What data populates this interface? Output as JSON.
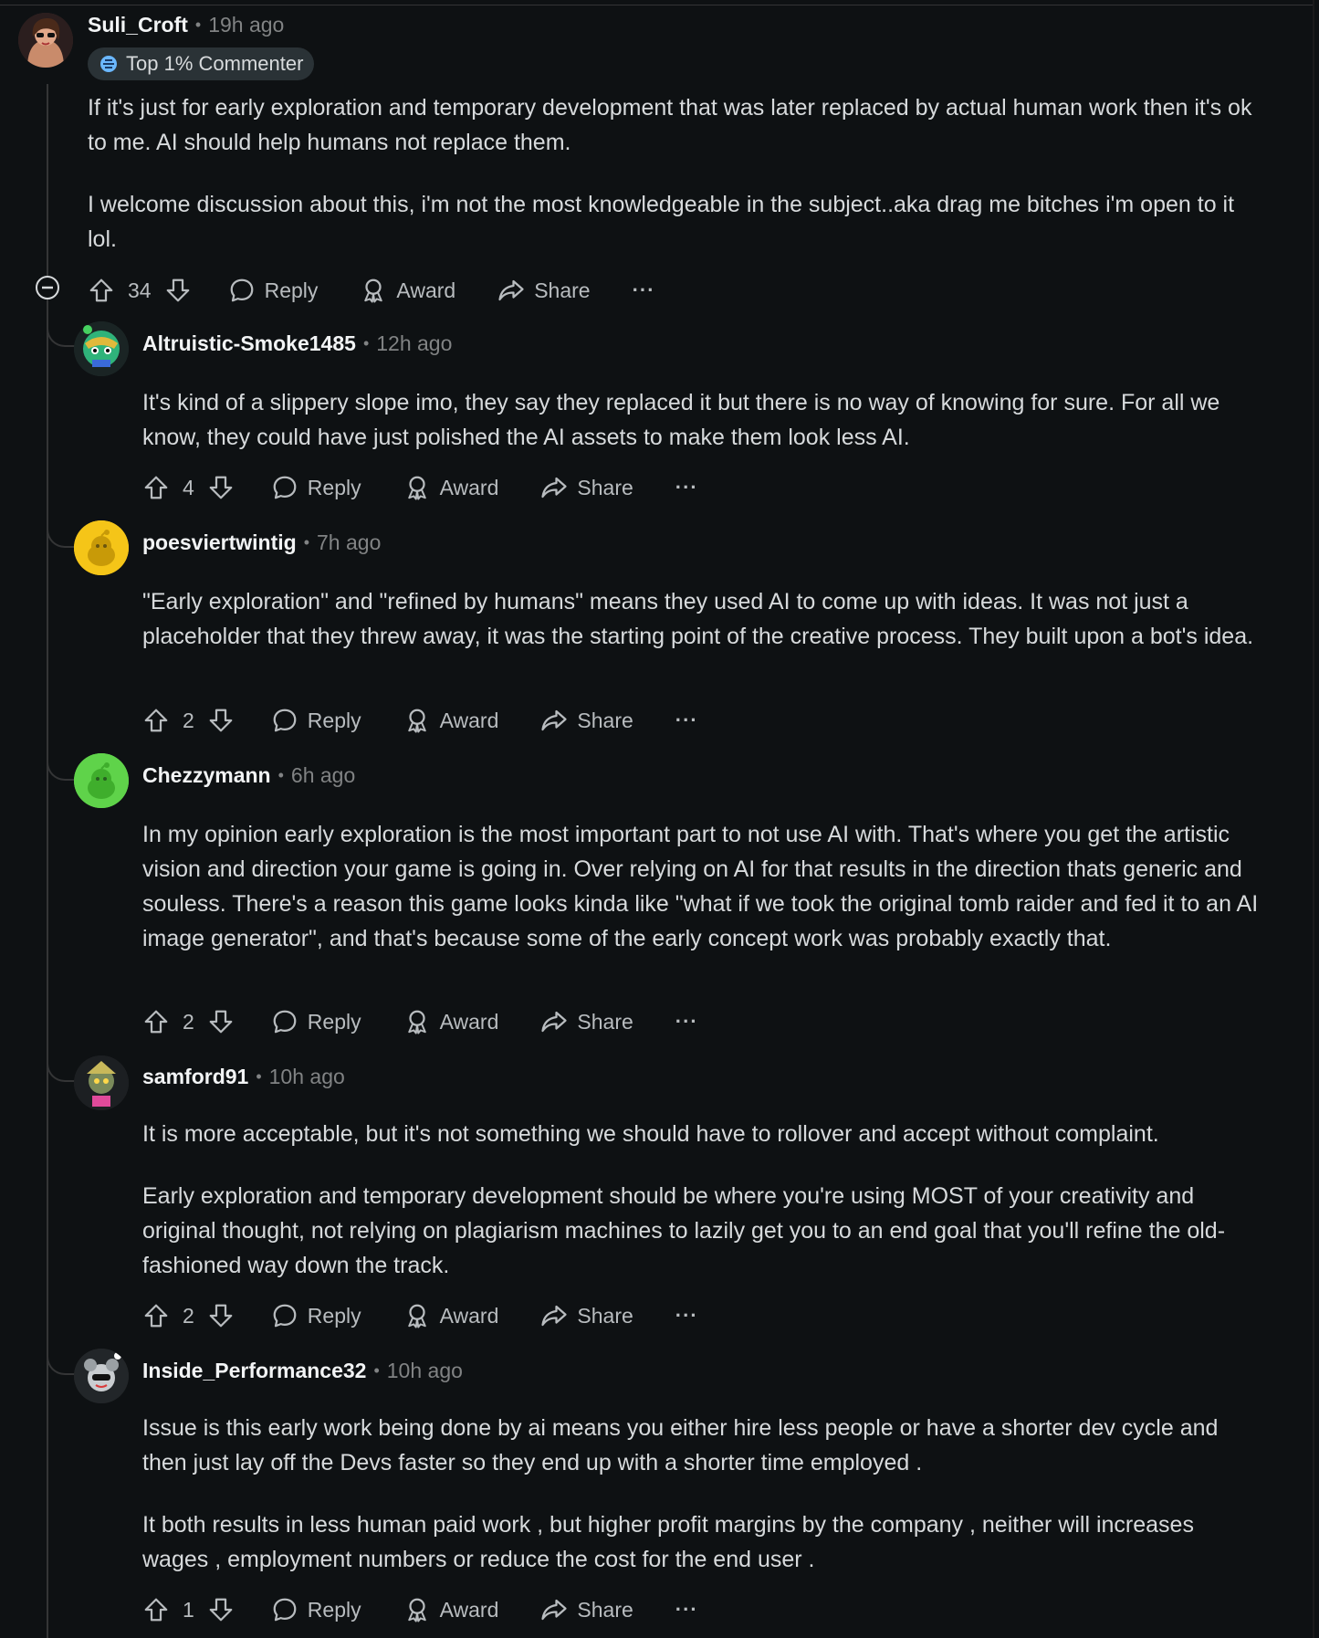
{
  "actions": {
    "reply": "Reply",
    "award": "Award",
    "share": "Share",
    "more": "···"
  },
  "comments": [
    {
      "author": "Suli_Croft",
      "time": "19h ago",
      "badge": "Top 1% Commenter",
      "paragraphs": [
        "If it's just for early exploration and temporary development that was later replaced by actual human work then it's ok to me. AI should help humans not replace them.",
        "I welcome discussion about this, i'm not the most knowledgeable in the subject..aka drag me bitches i'm open to it lol."
      ],
      "score": "34"
    },
    {
      "author": "Altruistic-Smoke1485",
      "time": "12h ago",
      "paragraphs": [
        "It's kind of a slippery slope imo, they say they replaced it but there is no way of knowing for sure. For all we know, they could have just polished the AI assets to make them look less AI."
      ],
      "score": "4"
    },
    {
      "author": "poesviertwintig",
      "time": "7h ago",
      "paragraphs": [
        "\"Early exploration\" and \"refined by humans\" means they used AI to come up with ideas. It was not just a placeholder that they threw away, it was the starting point of the creative process. They built upon a bot's idea."
      ],
      "score": "2"
    },
    {
      "author": "Chezzymann",
      "time": "6h ago",
      "paragraphs": [
        "In my opinion early exploration is the most important part to not use AI with. That's where you get the artistic vision and direction your game is going in. Over relying on AI for that results in the direction thats generic and souless. There's a reason this game looks kinda like \"what if we took the original tomb raider and fed it to an AI image generator\", and that's because some of the early concept work was probably exactly that."
      ],
      "score": "2"
    },
    {
      "author": "samford91",
      "time": "10h ago",
      "paragraphs": [
        "It is more acceptable, but it's not something we should have to rollover and accept without complaint.",
        "Early exploration and temporary development should be where you're using MOST of your creativity and original thought, not relying on plagiarism machines to lazily get you to an end goal that you'll refine the old-fashioned way down the track."
      ],
      "score": "2"
    },
    {
      "author": "Inside_Performance32",
      "time": "10h ago",
      "paragraphs": [
        "Issue is this early work being done by ai means you either hire less people or have a shorter dev cycle and then just lay off the Devs faster so they end up with a shorter time employed .",
        "It both results in less human paid work , but higher profit margins by the company , neither will increases wages , employment numbers or reduce the cost for the end user ."
      ],
      "score": "1"
    }
  ]
}
